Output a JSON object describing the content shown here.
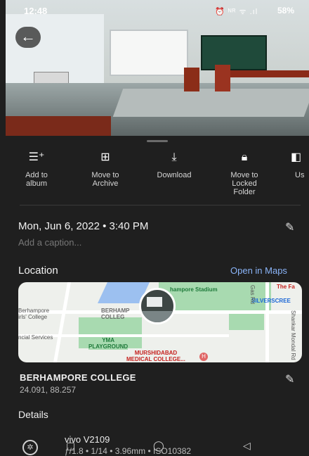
{
  "status_bar": {
    "time": "12:48",
    "icons_text": "⏰ ᴺᴿ ᯤ .ıl",
    "battery": "58%"
  },
  "actions": [
    {
      "icon": "add-to-album-icon",
      "label": "Add to\nalbum"
    },
    {
      "icon": "archive-icon",
      "label": "Move to\nArchive"
    },
    {
      "icon": "download-icon",
      "label": "Download"
    },
    {
      "icon": "lock-icon",
      "label": "Move to\nLocked\nFolder"
    },
    {
      "icon": "use-as-icon",
      "label": "Us"
    }
  ],
  "info": {
    "date_time": "Mon, Jun 6, 2022 • 3:40 PM",
    "caption_placeholder": "Add a caption..."
  },
  "location": {
    "title": "Location",
    "open_maps": "Open in Maps",
    "place_name": "BERHAMPORE COLLEGE",
    "coordinates": "24.091, 88.257",
    "map_labels": {
      "stadium": "hampore Stadium",
      "the_fa": "The Fa",
      "silverscreen": "SILVERSCREE",
      "berhampore_college": "BERHAMP\nCOLLEG",
      "girls_college": "Berhampore\nirls' College",
      "financial": "ncial Services",
      "yma": "YMA\nPLAYGROUND",
      "medical": "MURSHIDABAD\nMEDICAL COLLEGE...",
      "road1": "Gas Rd",
      "road2": "Shankar Mondal Rd"
    }
  },
  "details": {
    "title": "Details",
    "camera_model": "vivo V2109",
    "camera_specs": "ƒ/1.8 • 1/14 • 3.96mm • ISO10382"
  },
  "colors": {
    "background": "#1f1f1f",
    "link": "#8ab4f8",
    "text": "#f2f2f2"
  }
}
